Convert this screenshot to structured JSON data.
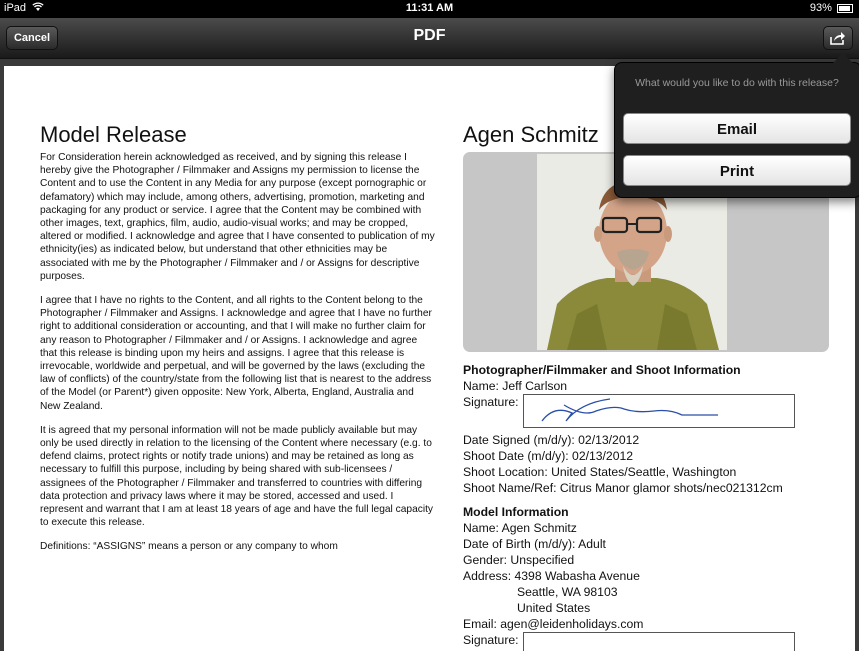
{
  "status_bar": {
    "device": "iPad",
    "time": "11:31 AM",
    "battery": "93%"
  },
  "nav": {
    "cancel_label": "Cancel",
    "title": "PDF"
  },
  "document": {
    "title": "Model Release",
    "paragraphs": [
      "For Consideration herein acknowledged as received, and by signing this release I hereby give the Photographer / Filmmaker and Assigns my permission to license the Content and to use the Content in any Media for any purpose (except pornographic or defamatory) which may include, among others, advertising, promotion, marketing and packaging for any product or service. I agree that the Content may be combined with other images, text, graphics, film, audio, audio-visual works; and may be cropped, altered or modified. I acknowledge and agree that I have consented to publication of my ethnicity(ies) as indicated below, but understand that other ethnicities may be associated with me by the Photographer / Filmmaker and / or Assigns for descriptive purposes.",
      "I agree that I have no rights to the Content, and all rights to the Content belong to the Photographer / Filmmaker and Assigns. I acknowledge and agree that I have no further right to additional consideration or accounting, and that I will make no further claim for any reason to Photographer / Filmmaker and / or Assigns. I acknowledge and agree that this release is binding upon my heirs and assigns. I agree that this release is irrevocable, worldwide and perpetual, and will be governed by the laws (excluding the law of conflicts) of the country/state from the following list that is nearest to the address of the Model (or Parent*) given opposite: New York, Alberta, England, Australia and New Zealand.",
      "It is agreed that my personal information will not be made publicly available but may only be used directly in relation to the licensing of the Content where necessary (e.g. to defend claims, protect rights or notify trade unions) and may be retained as long as necessary to fulfill this purpose, including by being shared with sub-licensees / assignees of the Photographer / Filmmaker and transferred to countries with differing data protection and privacy laws where it may be stored, accessed and used. I represent and warrant that I am at least 18 years of age and have the full legal capacity to execute this release.",
      "Definitions: “ASSIGNS” means a person or any company to whom"
    ],
    "model_name_heading": "Agen Schmitz",
    "photographer_section": {
      "heading": "Photographer/Filmmaker and Shoot Information",
      "name_line": "Name: Jeff Carlson",
      "signature_label": "Signature:",
      "date_signed": "Date Signed (m/d/y): 02/13/2012",
      "shoot_date": "Shoot Date (m/d/y): 02/13/2012",
      "shoot_location": "Shoot Location: United States/Seattle, Washington",
      "shoot_name": "Shoot Name/Ref: Citrus Manor glamor shots/nec021312cm"
    },
    "model_section": {
      "heading": "Model Information",
      "name_line": "Name: Agen Schmitz",
      "dob": "Date of Birth (m/d/y): Adult",
      "gender": "Gender: Unspecified",
      "address_line1": "Address: 4398 Wabasha Avenue",
      "address_line2": "Seattle, WA 98103",
      "address_line3": "United States",
      "email": "Email: agen@leidenholidays.com",
      "signature_label": "Signature:"
    }
  },
  "popover": {
    "message": "What would you like to do with this release?",
    "email_label": "Email",
    "print_label": "Print"
  },
  "icons": {
    "wifi": "wifi-icon",
    "battery": "battery-icon",
    "share": "share-icon",
    "signature": "signature-scribble"
  },
  "colors": {
    "nav_bar": "#2a2a2a",
    "signature_ink": "#2b4fa8",
    "popover_bg": "#1f1f1f"
  }
}
